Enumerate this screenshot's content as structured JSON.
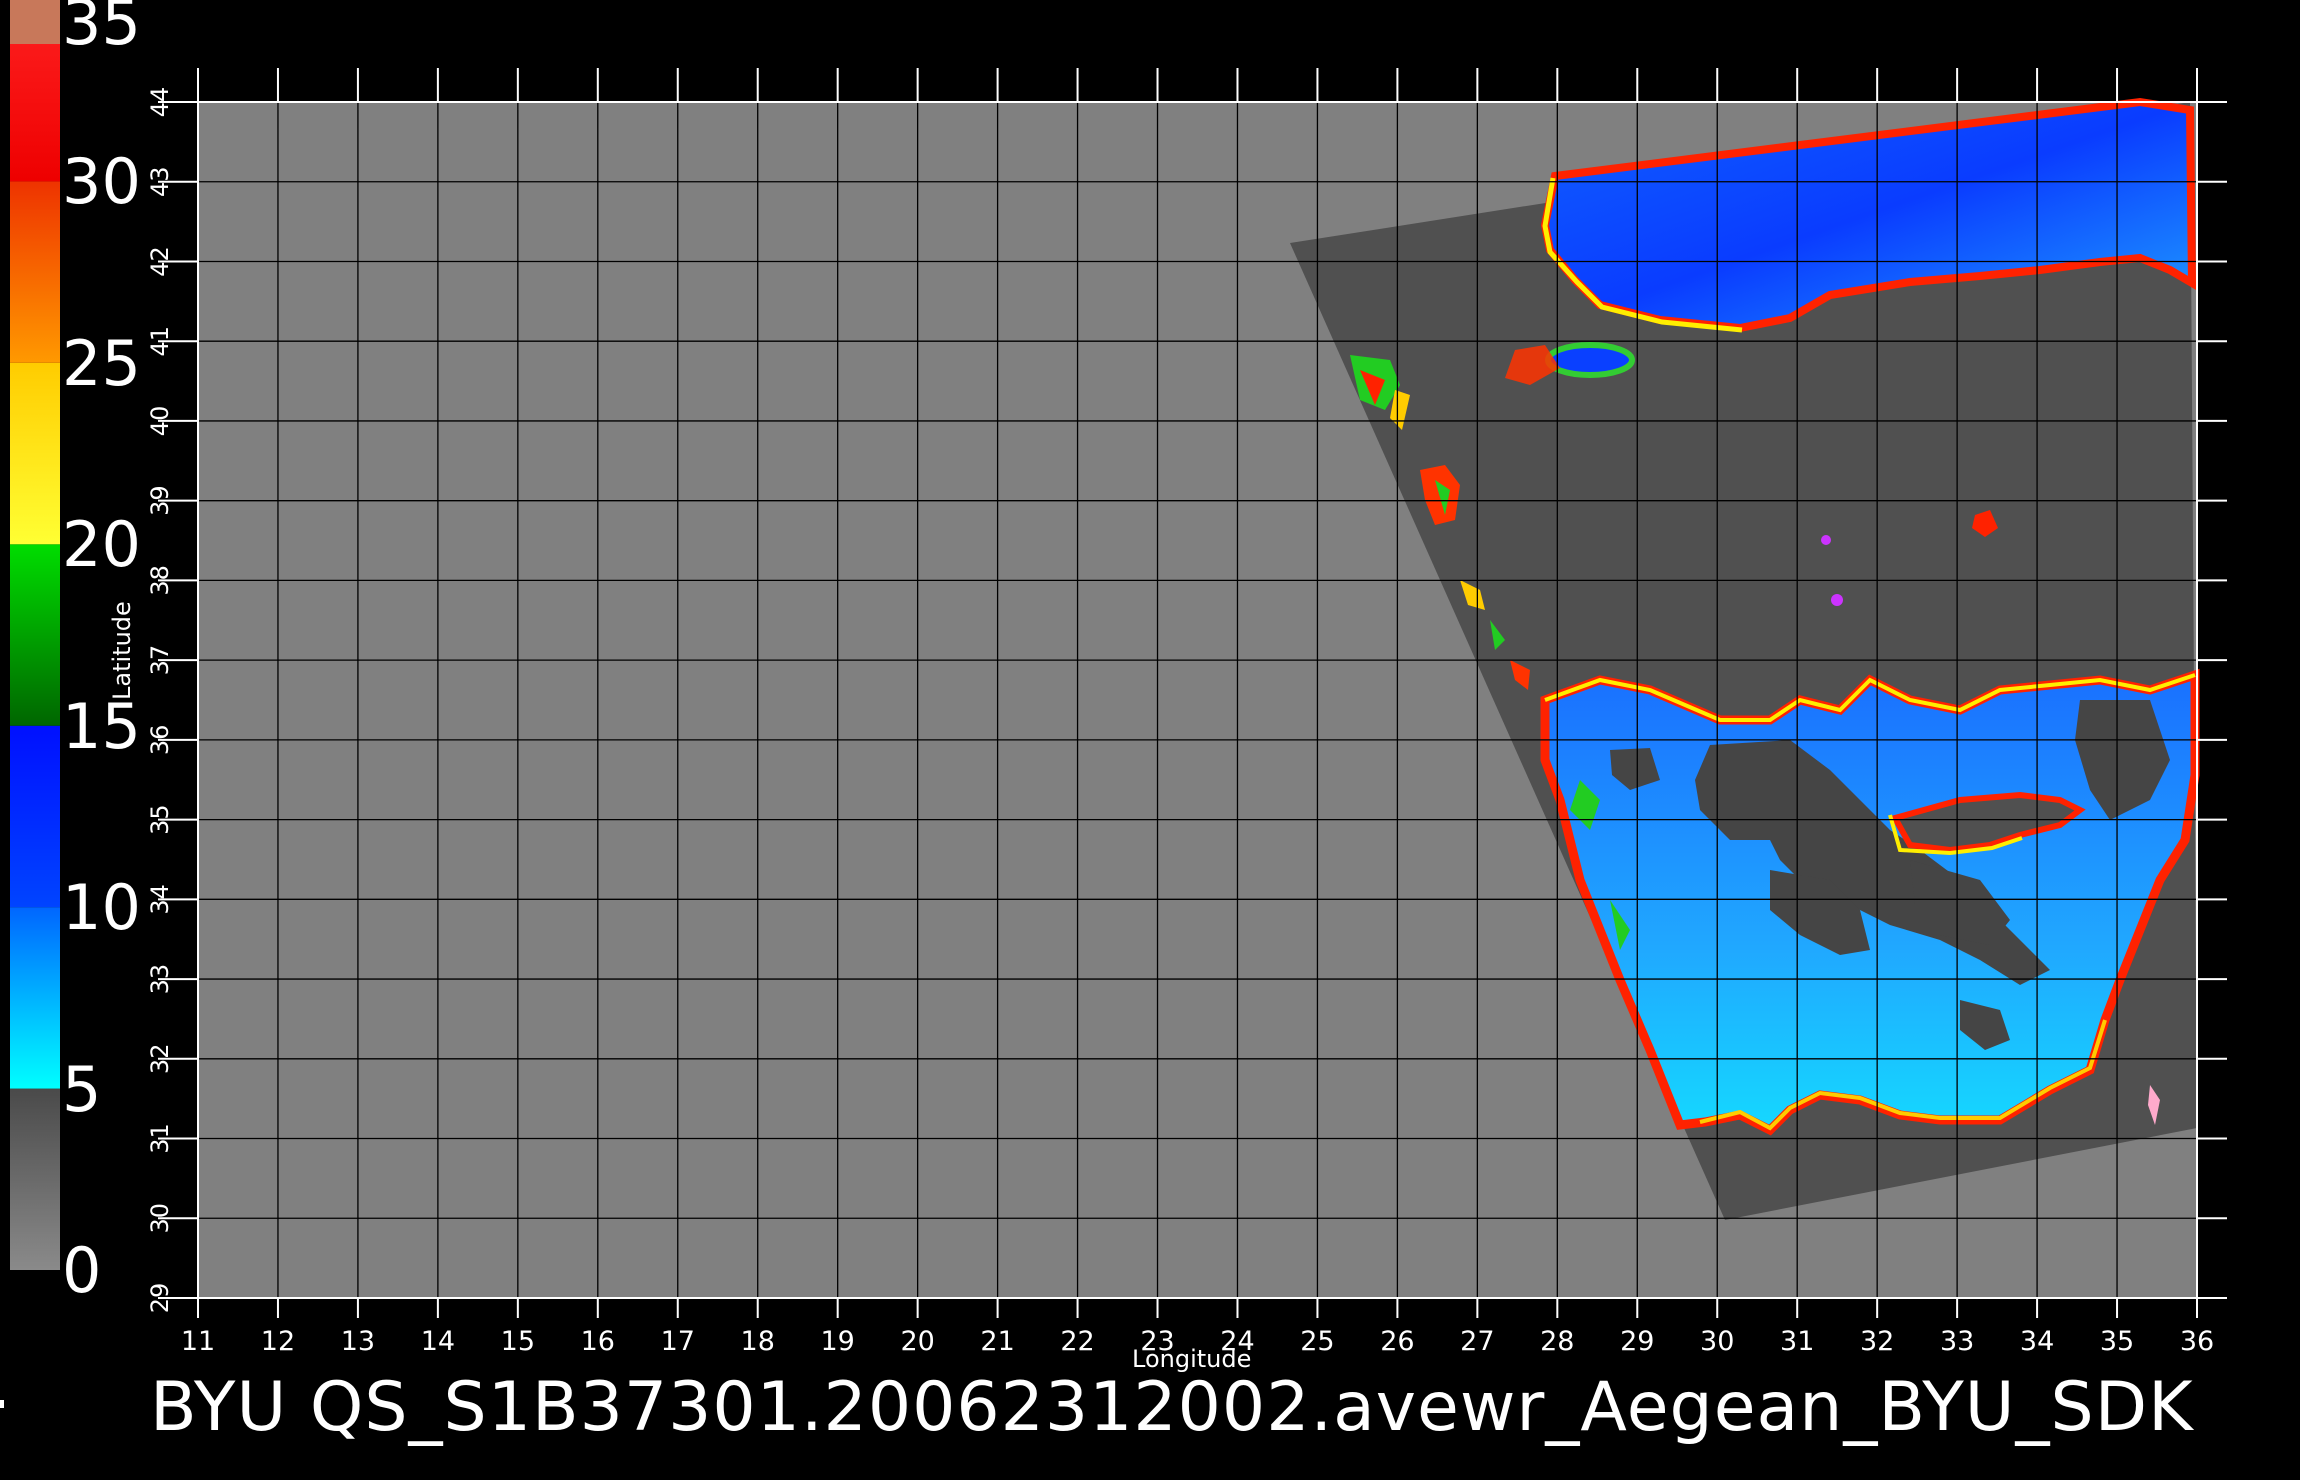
{
  "colorbar": {
    "labels": [
      "0",
      "5",
      "10",
      "15",
      "20",
      "25",
      "30",
      "35"
    ],
    "segments": [
      {
        "from": 0,
        "to": 5,
        "color_top": "#4a4a4a",
        "color_bottom": "#8a8a8a"
      },
      {
        "from": 5,
        "to": 10,
        "color_top": "#0066ff",
        "color_bottom": "#00ffff"
      },
      {
        "from": 10,
        "to": 15,
        "color_top": "#0010ff",
        "color_bottom": "#0044ff"
      },
      {
        "from": 15,
        "to": 20,
        "color_top": "#00dd00",
        "color_bottom": "#006600"
      },
      {
        "from": 20,
        "to": 25,
        "color_top": "#ffcc00",
        "color_bottom": "#ffff33"
      },
      {
        "from": 25,
        "to": 30,
        "color_top": "#ee3300",
        "color_bottom": "#ff9900"
      },
      {
        "from": 30,
        "to": 35,
        "color_top": "#ff2222",
        "color_bottom": "#ee0000"
      }
    ],
    "cap_color": "#c8785a"
  },
  "map": {
    "land_color": "#808080",
    "swath_color": "#505050",
    "grid_color": "#000000",
    "frame_color": "#ffffff",
    "lon_range": [
      11,
      36
    ],
    "lat_range": [
      29,
      44
    ],
    "lon_ticks": [
      "11",
      "12",
      "13",
      "14",
      "15",
      "16",
      "17",
      "18",
      "19",
      "20",
      "21",
      "22",
      "23",
      "24",
      "25",
      "26",
      "27",
      "28",
      "29",
      "30",
      "31",
      "32",
      "33",
      "34",
      "35",
      "36"
    ],
    "lat_ticks": [
      "29",
      "30",
      "31",
      "32",
      "33",
      "34",
      "35",
      "36",
      "37",
      "38",
      "39",
      "40",
      "41",
      "42",
      "43",
      "44"
    ],
    "xlabel": "Longitude",
    "ylabel": "Latitude"
  },
  "caption": "BYU  QS_S1B37301.20062312002.avewr_Aegean_BYU_SDK"
}
